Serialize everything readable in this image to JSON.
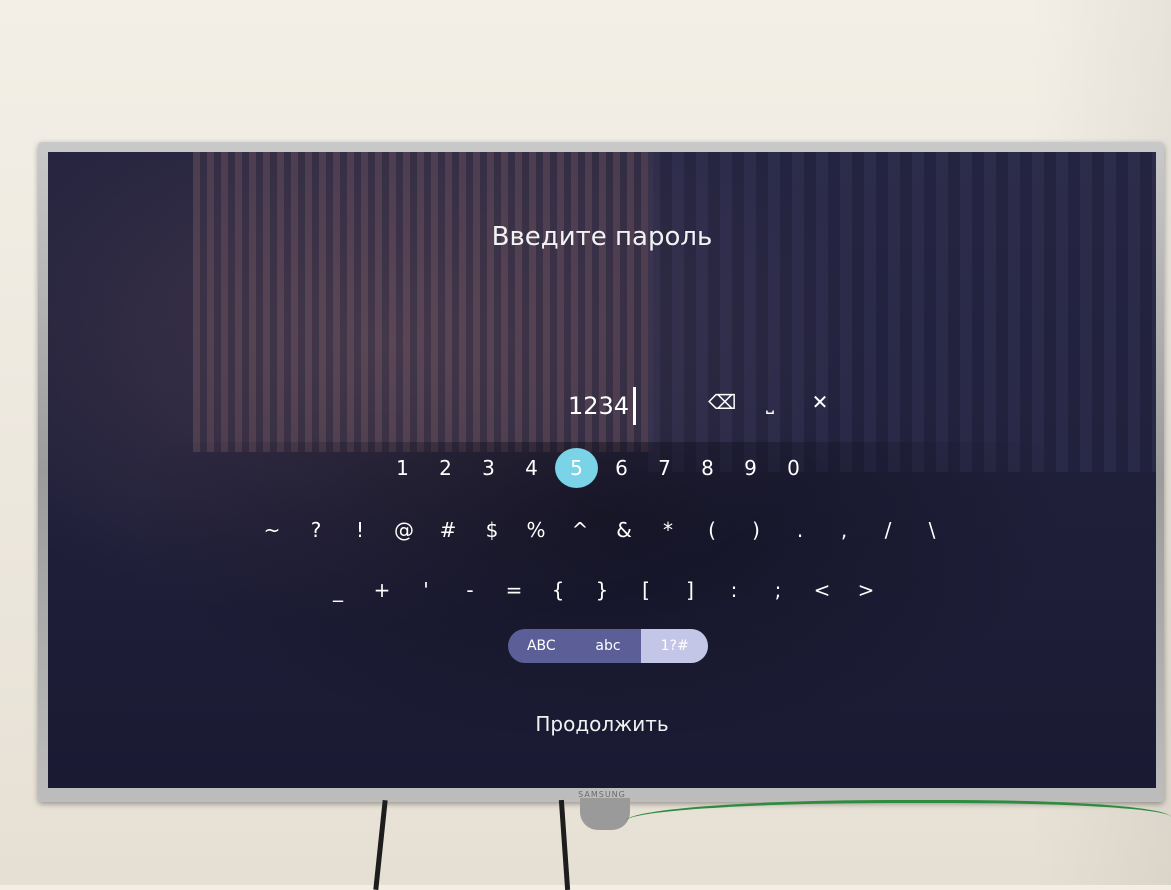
{
  "screen": {
    "title": "Введите пароль",
    "input_value": "1234",
    "actions": [
      {
        "name": "backspace-icon",
        "glyph": "⌫"
      },
      {
        "name": "space-icon",
        "glyph": "⎵"
      },
      {
        "name": "close-icon",
        "glyph": "✕"
      }
    ],
    "keyboard": {
      "selected_key": "5",
      "row1": [
        "1",
        "2",
        "3",
        "4",
        "5",
        "6",
        "7",
        "8",
        "9",
        "0"
      ],
      "row2": [
        "~",
        "?",
        "!",
        "@",
        "#",
        "$",
        "%",
        "^",
        "&",
        "*",
        "(",
        ")",
        ".",
        ",",
        "/",
        "\\"
      ],
      "row3": [
        "_",
        "+",
        "'",
        "-",
        "=",
        "{",
        "}",
        "[",
        "]",
        ":",
        ";",
        "<",
        ">"
      ]
    },
    "modes": [
      "ABC",
      "abc",
      "1?#"
    ],
    "active_mode": "1?#",
    "continue_label": "Продолжить"
  },
  "tv": {
    "brand": "SAMSUNG"
  },
  "colors": {
    "highlight": "#7ad3e6",
    "toggle_bg": "#5c5f97",
    "toggle_active": "#c3c6e6"
  }
}
